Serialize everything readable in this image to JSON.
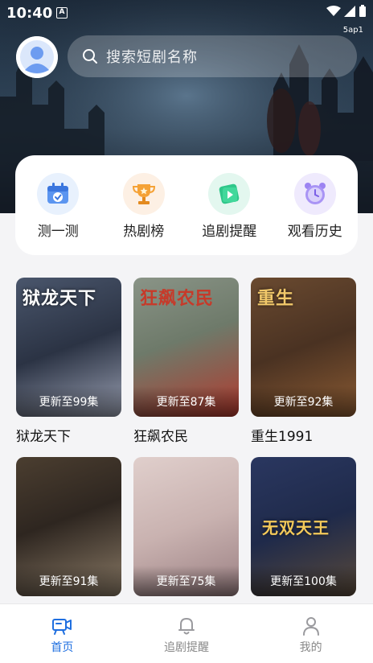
{
  "status_bar": {
    "time": "10:40",
    "notification_icon": "A",
    "carrier": "5ap1"
  },
  "header": {
    "search_placeholder": "搜索短剧名称"
  },
  "quick_actions": [
    {
      "label": "测一测",
      "icon": "calendar-check-icon"
    },
    {
      "label": "热剧榜",
      "icon": "trophy-icon"
    },
    {
      "label": "追剧提醒",
      "icon": "play-card-icon"
    },
    {
      "label": "观看历史",
      "icon": "clock-icon"
    }
  ],
  "dramas": [
    {
      "title": "狱龙天下",
      "poster_text": "狱龙天下",
      "update": "更新至99集",
      "colors": [
        "#3a4658",
        "#8a8fa0"
      ]
    },
    {
      "title": "狂飙农民",
      "poster_text": "狂飙农民",
      "update": "更新至87集",
      "colors": [
        "#6e7a6a",
        "#b23a2e"
      ]
    },
    {
      "title": "重生1991",
      "poster_text": "重生",
      "update": "更新至92集",
      "colors": [
        "#5a3f2c",
        "#8a5a32"
      ]
    },
    {
      "title": "",
      "poster_text": "",
      "update": "更新至91集",
      "colors": [
        "#3b3228",
        "#8a7a66"
      ]
    },
    {
      "title": "",
      "poster_text": "",
      "update": "更新至75集",
      "colors": [
        "#c9b2b0",
        "#9a7f82"
      ]
    },
    {
      "title": "",
      "poster_text": "无双天王",
      "update": "更新至100集",
      "colors": [
        "#1f2a4a",
        "#b58a3a"
      ]
    }
  ],
  "bottom_nav": [
    {
      "label": "首页",
      "icon": "home-camera-icon",
      "active": true
    },
    {
      "label": "追剧提醒",
      "icon": "bell-icon",
      "active": false
    },
    {
      "label": "我的",
      "icon": "person-icon",
      "active": false
    }
  ],
  "colors": {
    "accent": "#1f6fe0",
    "background": "#f4f4f6"
  }
}
